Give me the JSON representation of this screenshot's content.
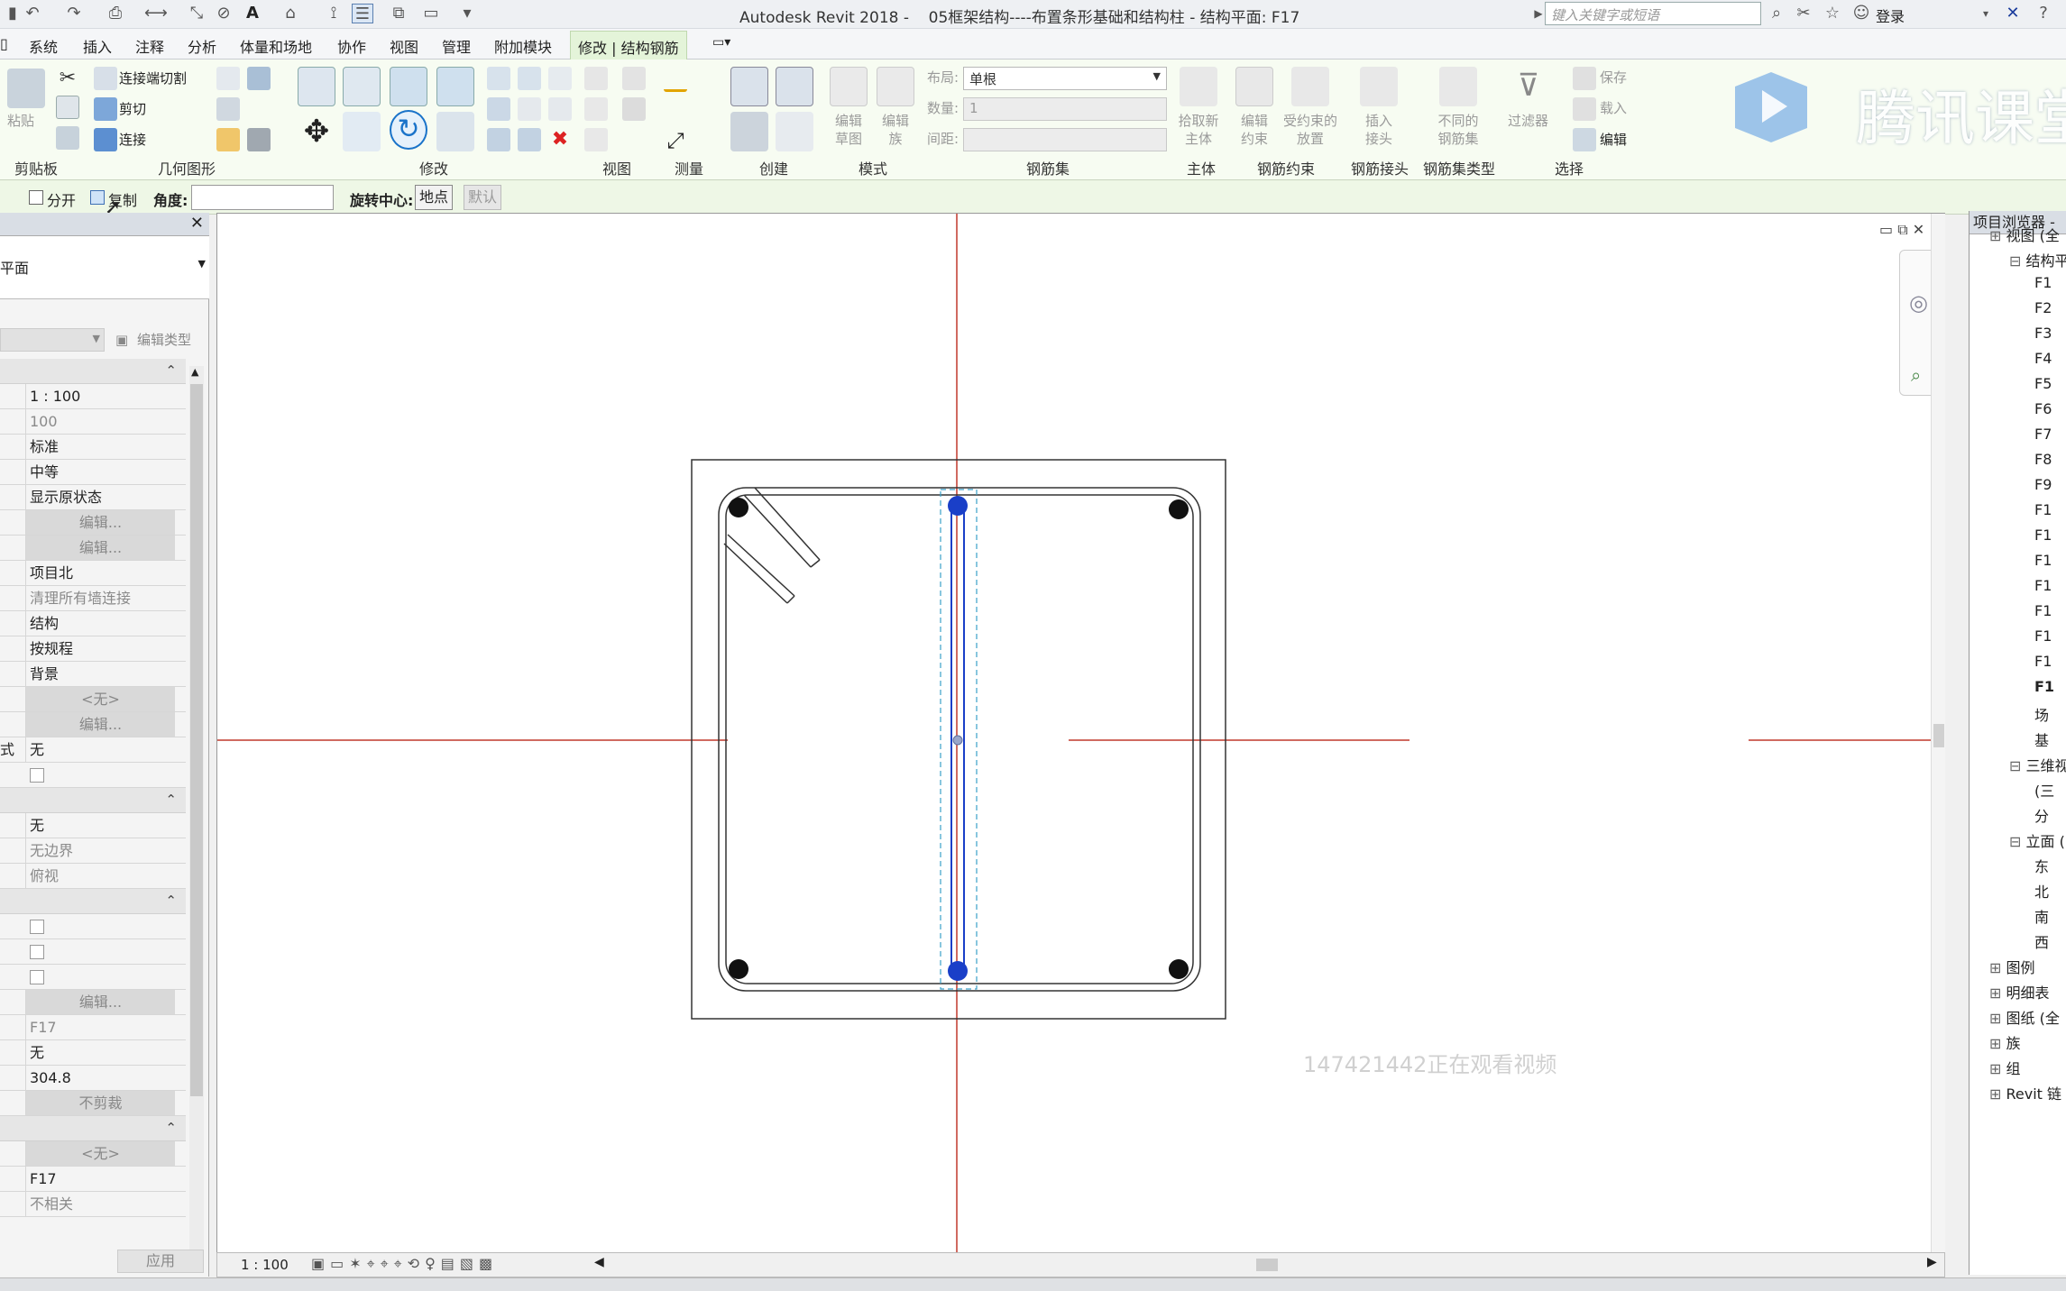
{
  "title": {
    "app": "Autodesk Revit 2018 -",
    "document": "05框架结构----布置条形基础和结构柱 - 结构平面: F17",
    "search_placeholder": "键入关键字或短语",
    "login": "登录"
  },
  "watermark": {
    "brand": "腾讯课堂",
    "viewer_notice": "147421442正在观看视频"
  },
  "menu": [
    "系统",
    "插入",
    "注释",
    "分析",
    "体量和场地",
    "协作",
    "视图",
    "管理",
    "附加模块",
    "修改 | 结构钢筋"
  ],
  "ribbon": {
    "clipboard": {
      "paste": "粘贴",
      "label": "剪贴板"
    },
    "geometry": {
      "join_cut": "连接端切割",
      "cut": "剪切",
      "join": "连接",
      "label": "几何图形"
    },
    "modify_label": "修改",
    "view_label": "视图",
    "measure_label": "测量",
    "create_label": "创建",
    "mode": {
      "edit_sketch": [
        "编辑",
        "草图"
      ],
      "edit_family": [
        "编辑",
        "族"
      ],
      "label": "模式"
    },
    "rebar_set": {
      "layout_label": "布局:",
      "layout_value": "单根",
      "count_label": "数量:",
      "count_value": "1",
      "spacing_label": "间距:",
      "label": "钢筋集"
    },
    "host": {
      "pick": [
        "拾取新",
        "主体"
      ],
      "label": "主体"
    },
    "constraints": {
      "edit": [
        "编辑",
        "约束"
      ],
      "place": [
        "受约束的",
        "放置"
      ],
      "label": "钢筋约束"
    },
    "coupler": {
      "insert": [
        "插入",
        "接头"
      ],
      "label": "钢筋接头"
    },
    "set_type": {
      "diff": [
        "不同的",
        "钢筋集"
      ],
      "label": "钢筋集类型"
    },
    "select": {
      "filter": "过滤器",
      "save": "保存",
      "load": "载入",
      "edit": "编辑",
      "label": "选择"
    }
  },
  "options": {
    "split": "分开",
    "copy": "复制",
    "angle_label": "角度:",
    "angle_value": "",
    "rotate_center": "旋转中心:",
    "place_btn": "地点",
    "default_btn": "默认"
  },
  "properties": {
    "type_value": "平面",
    "edit_type": "编辑类型",
    "scale": "1 : 100",
    "rows_a": [
      {
        "v": "100",
        "gray": true
      },
      {
        "v": "标准"
      },
      {
        "v": "中等"
      },
      {
        "v": "显示原状态"
      },
      {
        "v": "编辑...",
        "btn": true
      },
      {
        "v": "编辑...",
        "btn": true
      },
      {
        "v": "项目北"
      },
      {
        "v": "清理所有墙连接",
        "gray": true
      },
      {
        "v": "结构"
      },
      {
        "v": "按规程"
      },
      {
        "v": "背景"
      },
      {
        "v": "<无>",
        "btn": true
      },
      {
        "v": "编辑...",
        "btn": true
      },
      {
        "lbl": "式",
        "v": "无"
      },
      {
        "cb": true
      }
    ],
    "rows_b": [
      {
        "v": "无"
      },
      {
        "v": "无边界",
        "gray": true
      },
      {
        "v": "俯视",
        "gray": true
      }
    ],
    "rows_c": [
      {
        "cb": true
      },
      {
        "cb": true
      },
      {
        "cb": true
      },
      {
        "v": "编辑...",
        "btn": true
      },
      {
        "v": "F17",
        "gray": true
      },
      {
        "v": "无"
      },
      {
        "v": "304.8"
      },
      {
        "v": "不剪裁",
        "btn": true
      }
    ],
    "rows_d": [
      {
        "v": "<无>",
        "btn": true
      },
      {
        "v": "F17"
      },
      {
        "v": "不相关",
        "gray": true
      }
    ],
    "apply": "应用"
  },
  "browser": {
    "title": "项目浏览器 -",
    "items": [
      {
        "t": "视图 (全",
        "d": 1
      },
      {
        "t": "结构平",
        "d": 2
      },
      {
        "t": "F1",
        "d": 3
      },
      {
        "t": "F2",
        "d": 3
      },
      {
        "t": "F3",
        "d": 3
      },
      {
        "t": "F4",
        "d": 3
      },
      {
        "t": "F5",
        "d": 3
      },
      {
        "t": "F6",
        "d": 3
      },
      {
        "t": "F7",
        "d": 3
      },
      {
        "t": "F8",
        "d": 3
      },
      {
        "t": "F9",
        "d": 3
      },
      {
        "t": "F1",
        "d": 3
      },
      {
        "t": "F1",
        "d": 3
      },
      {
        "t": "F1",
        "d": 3
      },
      {
        "t": "F1",
        "d": 3
      },
      {
        "t": "F1",
        "d": 3
      },
      {
        "t": "F1",
        "d": 3
      },
      {
        "t": "F1",
        "d": 3
      },
      {
        "t": "F1",
        "d": 3,
        "bold": true
      },
      {
        "t": "场",
        "d": 3
      },
      {
        "t": "基",
        "d": 3
      },
      {
        "t": "三维视",
        "d": 2
      },
      {
        "t": "(三",
        "d": 3
      },
      {
        "t": "分",
        "d": 3
      },
      {
        "t": "立面 (",
        "d": 2
      },
      {
        "t": "东",
        "d": 3
      },
      {
        "t": "北",
        "d": 3
      },
      {
        "t": "南",
        "d": 3
      },
      {
        "t": "西",
        "d": 3
      },
      {
        "t": "图例",
        "d": 1
      },
      {
        "t": "明细表",
        "d": 1
      },
      {
        "t": "图纸 (全",
        "d": 1
      },
      {
        "t": "族",
        "d": 1
      },
      {
        "t": "组",
        "d": 1
      },
      {
        "t": "Revit 链",
        "d": 1
      }
    ]
  },
  "status": {
    "scale": "1 : 100"
  },
  "colors": {
    "ribbon": "#f7fcf2",
    "accent": "#1a3fc8",
    "axis": "#c0392b"
  }
}
